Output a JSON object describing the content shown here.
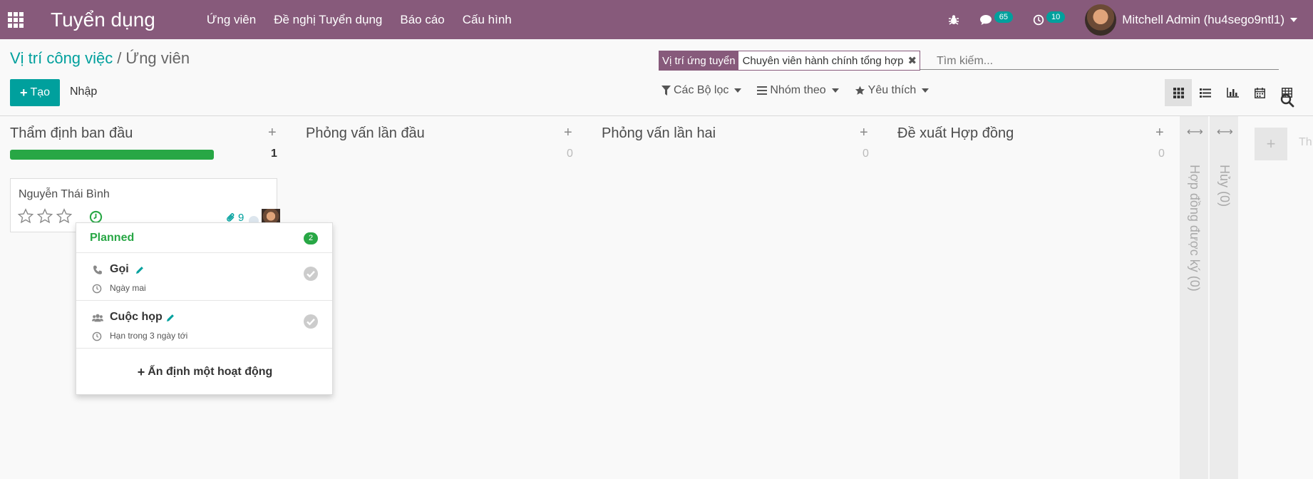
{
  "navbar": {
    "app_title": "Tuyển dụng",
    "menu": [
      "Ứng viên",
      "Đề nghị Tuyển dụng",
      "Báo cáo",
      "Cấu hình"
    ],
    "messages_count": "65",
    "activities_count": "10",
    "user_name": "Mitchell Admin (hu4sego9ntl1)"
  },
  "breadcrumb": {
    "parent": "Vị trí công việc",
    "separator": "/",
    "current": "Ứng viên"
  },
  "buttons": {
    "create": "Tạo",
    "import": "Nhập"
  },
  "search": {
    "facet_label": "Vị trí ứng tuyển",
    "facet_value": "Chuyên viên hành chính tổng hợp",
    "placeholder": "Tìm kiếm..."
  },
  "filters": {
    "filter": "Các Bộ lọc",
    "group_by": "Nhóm theo",
    "favorites": "Yêu thích"
  },
  "colors": {
    "brand": "#875a7b",
    "accent": "#00a09d",
    "success": "#28a745"
  },
  "columns": [
    {
      "title": "Thẩm định ban đầu",
      "count": "1"
    },
    {
      "title": "Phỏng vấn lần đầu",
      "count": "0"
    },
    {
      "title": "Phỏng vấn lần hai",
      "count": "0"
    },
    {
      "title": "Đề xuất Hợp đồng",
      "count": "0"
    }
  ],
  "folded_columns": [
    "Hợp đồng được ký (0)",
    "Hủy (0)"
  ],
  "quick_add_label": "Th",
  "card": {
    "name": "Nguyễn Thái Bình",
    "attachments": "9"
  },
  "popover": {
    "title": "Planned",
    "count": "2",
    "activities": [
      {
        "title": "Gọi",
        "date": "Ngày mai",
        "icon": "phone-icon"
      },
      {
        "title": "Cuộc họp",
        "date": "Hạn trong 3 ngày tới",
        "icon": "users-icon"
      }
    ],
    "schedule_label": "Ấn định một hoạt động"
  }
}
